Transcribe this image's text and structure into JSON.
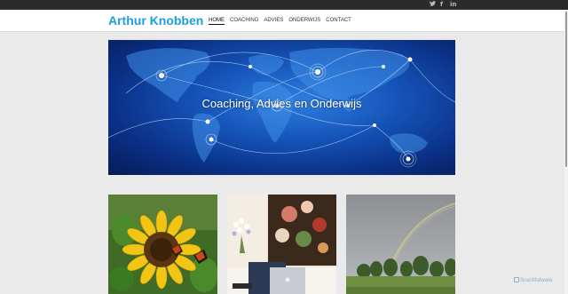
{
  "site": {
    "title": "Arthur Knobben"
  },
  "social": [
    {
      "icon": "twitter-icon",
      "glyph": "🐦"
    },
    {
      "icon": "facebook-icon",
      "glyph": "f"
    },
    {
      "icon": "linkedin-icon",
      "glyph": "in"
    }
  ],
  "nav": {
    "items": [
      "HOME",
      "COACHING",
      "ADVIES",
      "ONDERWIJS",
      "CONTACT"
    ],
    "active": "HOME"
  },
  "hero": {
    "title": "Coaching, Advies en Onderwijs"
  },
  "badge": {
    "label": "ScanMalware"
  },
  "colors": {
    "accent": "#1aa0dc",
    "topbar": "#2b2b2b",
    "background": "#eaeaea"
  }
}
